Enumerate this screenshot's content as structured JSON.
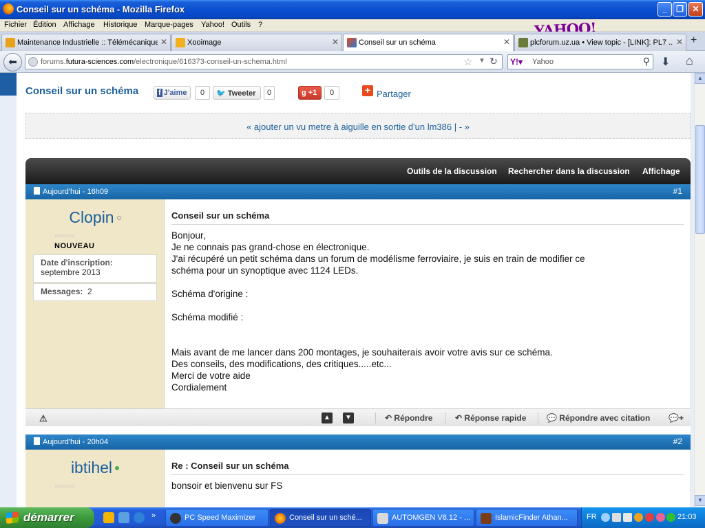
{
  "window": {
    "title": "Conseil sur un schéma - Mozilla Firefox"
  },
  "menu": [
    "Fichier",
    "Édition",
    "Affichage",
    "Historique",
    "Marque-pages",
    "Yahoo!",
    "Outils",
    "?"
  ],
  "yahoo_logo": "YAHOO!",
  "tabs": [
    {
      "label": "Maintenance Industrielle :: Télémécanique ..."
    },
    {
      "label": "Xooimage"
    },
    {
      "label": "Conseil sur un schéma"
    },
    {
      "label": "plcforum.uz.ua • View topic - [LINK]: PL7 ..."
    }
  ],
  "nav": {
    "url_prefix": "forums.",
    "url_domain": "futura-sciences.com",
    "url_path": "/electronique/616373-conseil-un-schema.html",
    "search_placeholder": "Yahoo"
  },
  "thread": {
    "title": "Conseil sur un schéma",
    "fb_label": "J'aime",
    "fb_count": "0",
    "tw_label": "Tweeter",
    "tw_count": "0",
    "gp_label": "+1",
    "gp_count": "0",
    "share_label": "Partager",
    "nav_links": "« ajouter un vu metre à aiguille en sortie d'un lm386 | - »"
  },
  "toolbar": [
    "Outils de la discussion",
    "Rechercher dans la discussion",
    "Affichage"
  ],
  "posts": [
    {
      "date": "Aujourd'hui - 16h09",
      "number": "#1",
      "username": "Clopin",
      "rank": "NOUVEAU",
      "stars": "○○○○○",
      "join_label": "Date d'inscription:",
      "join_value": "septembre 2013",
      "messages_label": "Messages:",
      "messages_value": "2",
      "title": "Conseil sur un schéma",
      "lines": [
        "Bonjour,",
        "Je ne connais pas grand-chose en électronique.",
        "J'ai récupéré un petit schéma dans un forum de modélisme ferroviaire, je suis en train de modifier ce",
        "schéma pour un synoptique avec 1124 LEDs.",
        "",
        "Schéma d'origine :",
        "",
        "Schéma modifié :",
        "",
        "",
        "Mais avant de me lancer dans 200 montages, je souhaiterais avoir votre avis sur ce schéma.",
        "Des conseils, des modifications, des critiques.....etc...",
        "Merci de votre aide",
        "Cordialement"
      ],
      "footer": {
        "reply": "Répondre",
        "quick_reply": "Réponse rapide",
        "reply_quote": "Répondre avec citation"
      }
    },
    {
      "date": "Aujourd'hui - 20h04",
      "number": "#2",
      "username": "ibtihel",
      "stars": "○○○○○",
      "title": "Re : Conseil sur un schéma",
      "lines": [
        "bonsoir et bienvenu sur FS"
      ]
    }
  ],
  "taskbar": {
    "start": "démarrer",
    "tasks": [
      "PC Speed Maximizer",
      "Conseil sur un sché...",
      "AUTOMGEN V8.12 - ...",
      "IslamicFinder Athan..."
    ],
    "lang": "FR",
    "clock": "21:03"
  }
}
